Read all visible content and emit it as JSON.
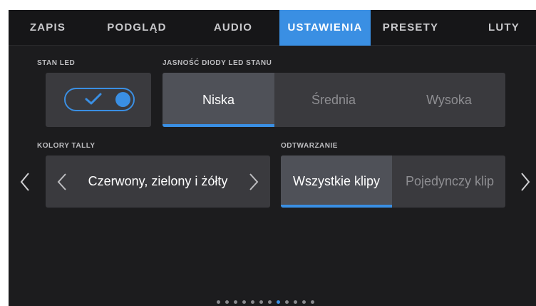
{
  "tabs": [
    {
      "label": "ZAPIS"
    },
    {
      "label": "PODGLĄD"
    },
    {
      "label": "AUDIO"
    },
    {
      "label": "USTAWIENIA"
    },
    {
      "label": "PRESETY"
    },
    {
      "label": "LUTY"
    }
  ],
  "active_tab": "USTAWIENIA",
  "led": {
    "label": "STAN LED",
    "toggle_on": true
  },
  "led_brightness": {
    "label": "JASNOŚĆ DIODY LED STANU",
    "options": [
      "Niska",
      "Średnia",
      "Wysoka"
    ],
    "selected": "Niska"
  },
  "tally": {
    "label": "KOLORY TALLY",
    "value": "Czerwony, zielony i żółty"
  },
  "playback": {
    "label": "ODTWARZANIE",
    "options": [
      "Wszystkie klipy",
      "Pojedynczy klip"
    ],
    "selected": "Wszystkie klipy"
  },
  "pagination": {
    "total": 12,
    "current": 7
  },
  "colors": {
    "accent": "#3a8fe3",
    "panel": "#1c1c1e",
    "tile": "#3a3a3e"
  },
  "icons": [
    "check-icon",
    "chevron-left-icon",
    "chevron-right-icon"
  ]
}
